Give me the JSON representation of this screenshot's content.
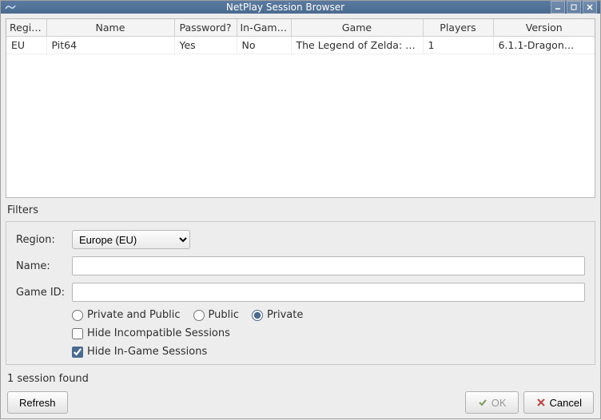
{
  "window": {
    "title": "NetPlay Session Browser"
  },
  "table": {
    "columns": [
      "Region",
      "Name",
      "Password?",
      "In-Game?",
      "Game",
      "Players",
      "Version"
    ],
    "rows": [
      {
        "region": "EU",
        "name": "Pit64",
        "password": "Yes",
        "ingame": "No",
        "game": "The Legend of Zelda: Fo…",
        "players": "1",
        "version": "6.1.1-Dragon…"
      }
    ]
  },
  "filters": {
    "section_label": "Filters",
    "region_label": "Region:",
    "region_value": "Europe (EU)",
    "name_label": "Name:",
    "name_value": "",
    "gameid_label": "Game ID:",
    "gameid_value": "",
    "radios": {
      "private_public": "Private and Public",
      "public": "Public",
      "private": "Private",
      "selected": "private"
    },
    "hide_incompatible": {
      "label": "Hide Incompatible Sessions",
      "checked": false
    },
    "hide_ingame": {
      "label": "Hide In-Game Sessions",
      "checked": true
    }
  },
  "status": "1 session found",
  "buttons": {
    "refresh": "Refresh",
    "ok": "OK",
    "cancel": "Cancel"
  }
}
